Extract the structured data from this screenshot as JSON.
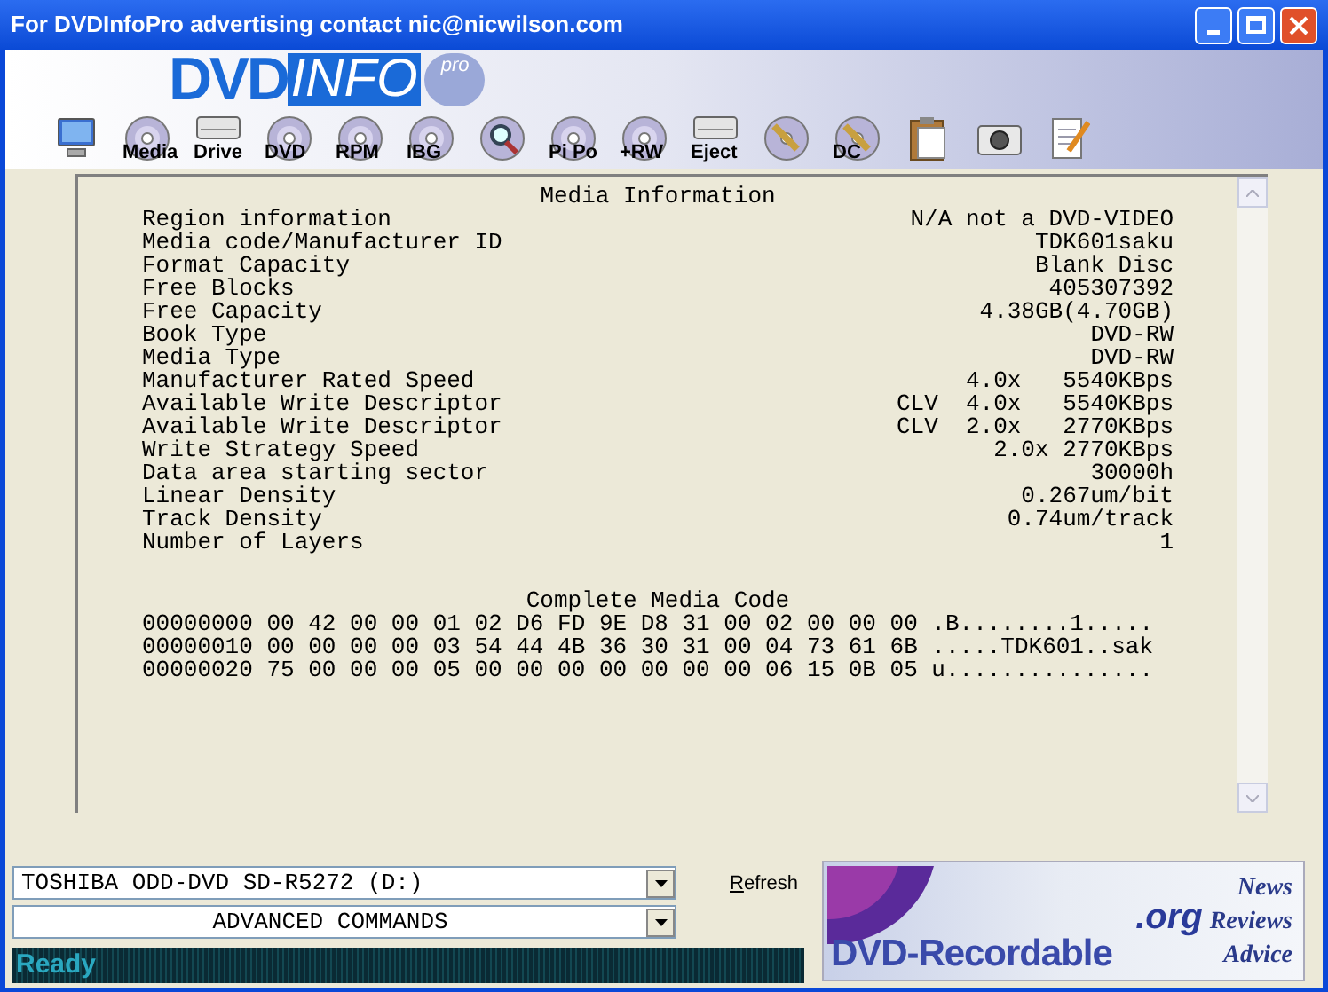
{
  "window": {
    "title": "For DVDInfoPro advertising contact nic@nicwilson.com"
  },
  "logo": {
    "left": "DVD",
    "right": "INFO",
    "badge": "pro"
  },
  "toolbar": [
    {
      "kind": "monitor"
    },
    {
      "kind": "disc",
      "label": "Media"
    },
    {
      "kind": "drive",
      "label": "Drive"
    },
    {
      "kind": "disc",
      "label": "DVD"
    },
    {
      "kind": "disc",
      "label": "RPM"
    },
    {
      "kind": "disc",
      "label": "IBG"
    },
    {
      "kind": "magnifier"
    },
    {
      "kind": "disc",
      "label": "Pi Po"
    },
    {
      "kind": "disc",
      "label": "+RW"
    },
    {
      "kind": "drive",
      "label": "Eject"
    },
    {
      "kind": "pencil"
    },
    {
      "kind": "pencil",
      "label": "DC"
    },
    {
      "kind": "clipboard"
    },
    {
      "kind": "camera"
    },
    {
      "kind": "notepad"
    }
  ],
  "media_information": {
    "title": "Media Information",
    "rows": [
      {
        "label": "Region information",
        "value": "N/A not a DVD-VIDEO"
      },
      {
        "label": "Media code/Manufacturer ID",
        "value": "TDK601saku"
      },
      {
        "label": "Format Capacity",
        "value": "Blank Disc"
      },
      {
        "label": "Free Blocks",
        "value": "405307392"
      },
      {
        "label": "Free Capacity",
        "value": "4.38GB(4.70GB)"
      },
      {
        "label": "Book Type",
        "value": "DVD-RW"
      },
      {
        "label": "Media Type",
        "value": "DVD-RW"
      },
      {
        "label": "Manufacturer Rated Speed",
        "value": "4.0x   5540KBps"
      },
      {
        "label": "Available Write Descriptor",
        "value": "CLV  4.0x   5540KBps"
      },
      {
        "label": "Available Write Descriptor",
        "value": "CLV  2.0x   2770KBps"
      },
      {
        "label": "Write Strategy Speed",
        "value": "2.0x 2770KBps"
      },
      {
        "label": "Data area starting sector",
        "value": "30000h"
      },
      {
        "label": "Linear Density",
        "value": "0.267um/bit"
      },
      {
        "label": "Track Density",
        "value": "0.74um/track"
      },
      {
        "label": "Number of Layers",
        "value": "1"
      }
    ]
  },
  "media_code": {
    "title": "Complete Media Code",
    "lines": [
      "00000000 00 42 00 00 01 02 D6 FD 9E D8 31 00 02 00 00 00 .B........1.....",
      "00000010 00 00 00 00 03 54 44 4B 36 30 31 00 04 73 61 6B .....TDK601..sak",
      "00000020 75 00 00 00 05 00 00 00 00 00 00 00 06 15 0B 05 u..............."
    ]
  },
  "drive_select": {
    "value": "TOSHIBA ODD-DVD SD-R5272 (D:)"
  },
  "commands_select": {
    "value": "ADVANCED COMMANDS"
  },
  "refresh_button": "Refresh",
  "status_bar": "Ready",
  "banner": {
    "domain": ".org",
    "name": "DVD-Recordable",
    "links": [
      "News",
      "Reviews",
      "Advice"
    ]
  }
}
